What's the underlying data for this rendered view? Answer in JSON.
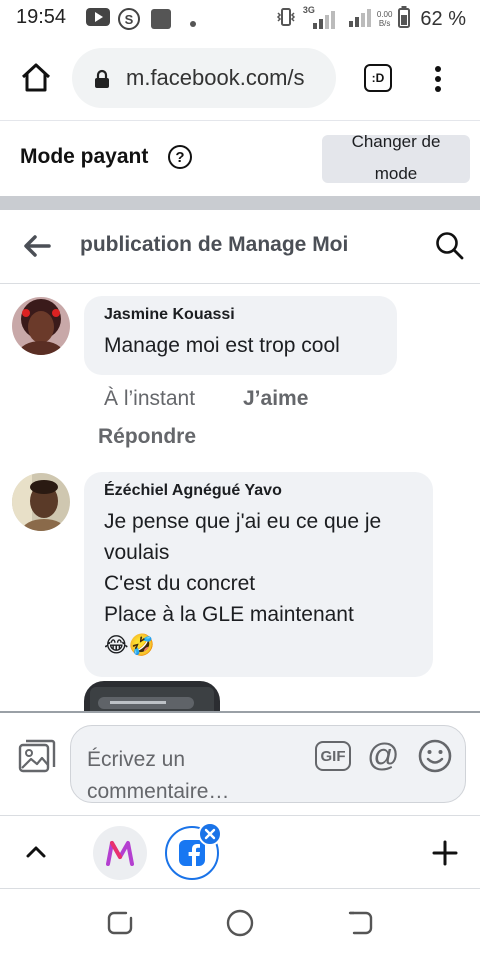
{
  "status_bar": {
    "time": "19:54",
    "network": "3G",
    "net_speed_value": "0.00",
    "net_speed_unit": "B/s",
    "battery_percent": "62 %"
  },
  "browser": {
    "url": "m.facebook.com/s",
    "tabs_label": ":D",
    "accent_color": "#1a73e8"
  },
  "mode_bar": {
    "title": "Mode payant",
    "help_label": "?",
    "change_mode_line1": "Changer de",
    "change_mode_line2": "mode"
  },
  "page_header": {
    "title": "publication de Manage Moi"
  },
  "comments": [
    {
      "author": "Jasmine Kouassi",
      "lines": [
        "Manage moi est trop cool"
      ],
      "time": "À l’instant",
      "like_label": "J’aime",
      "reply_label": "Répondre"
    },
    {
      "author": "Ézéchiel Agnégué Yavo",
      "lines": [
        "Je pense que j'ai eu ce que je",
        "voulais",
        "C'est du concret",
        "Place à la GLE maintenant",
        "😂🤣"
      ]
    }
  ],
  "composer": {
    "placeholder_line1": "Écrivez un",
    "placeholder_line2": "commentaire…",
    "gif_label": "GIF",
    "at_label": "@"
  },
  "tab_bar": {
    "manage_tab_letter": "M",
    "facebook_tab_letter": "f"
  }
}
